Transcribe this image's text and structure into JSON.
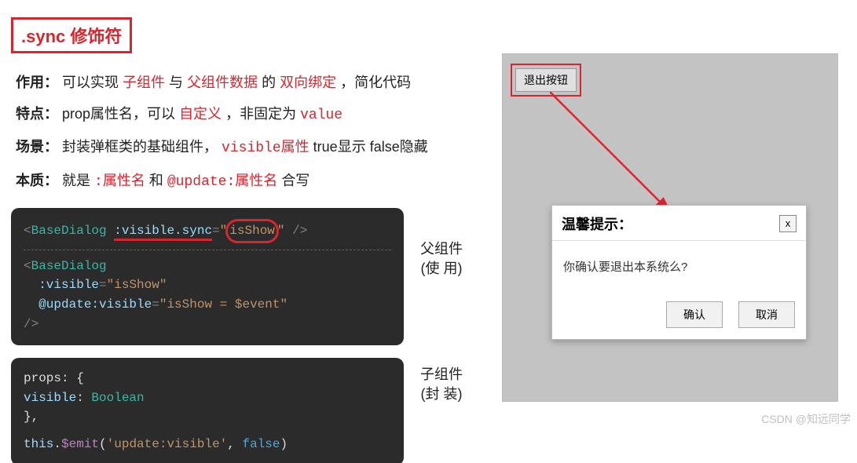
{
  "title": ".sync 修饰符",
  "lines": {
    "l1": {
      "label": "作用：",
      "p1": "可以实现 ",
      "r1": "子组件",
      "p2": " 与 ",
      "r2": "父组件数据",
      "p3": " 的 ",
      "r3": "双向绑定",
      "p4": "，简化代码"
    },
    "l2": {
      "label": "特点：",
      "p1": "prop属性名，可以",
      "r1": "自定义",
      "p2": "，非固定为 ",
      "r2": "value"
    },
    "l3": {
      "label": "场景：",
      "p1": "封装弹框类的基础组件，",
      "r1": "visible属性",
      "p2": " true显示 false隐藏"
    },
    "l4": {
      "label": "本质：",
      "p1": "就是 ",
      "r1": ":属性名",
      "p2": " 和 ",
      "r2": "@update:属性名",
      "p3": " 合写"
    }
  },
  "code1": {
    "tokens": {
      "lt1": "<",
      "tag": "BaseDialog",
      "sp": " ",
      "attr1": ":visible.sync",
      "eq": "=",
      "q": "\"",
      "val1": "isShow",
      "close1": "/>",
      "attr2a": ":visible",
      "val2a": "isShow",
      "attr2b": "@update:visible",
      "val2b": "isShow = $event",
      "closeTag": "/>"
    }
  },
  "code2": {
    "propsOpen": "props: {",
    "visibleKey": "  visible",
    "colon": ": ",
    "boolType": "Boolean",
    "propsClose": "},",
    "emitThis": "this",
    "dot": ".",
    "dollar": "$emit",
    "paren1": "(",
    "emitStr": "'update:visible'",
    "comma": ", ",
    "falseKw": "false",
    "paren2": ")"
  },
  "annot1": {
    "a": "父组件",
    "b": "(使  用)"
  },
  "annot2": {
    "a": "子组件",
    "b": "(封  装)"
  },
  "preview": {
    "exitBtn": "退出按钮",
    "dialog": {
      "title": "温馨提示：",
      "close": "x",
      "body": "你确认要退出本系统么?",
      "ok": "确认",
      "cancel": "取消"
    }
  },
  "watermark": "CSDN @知远同学"
}
